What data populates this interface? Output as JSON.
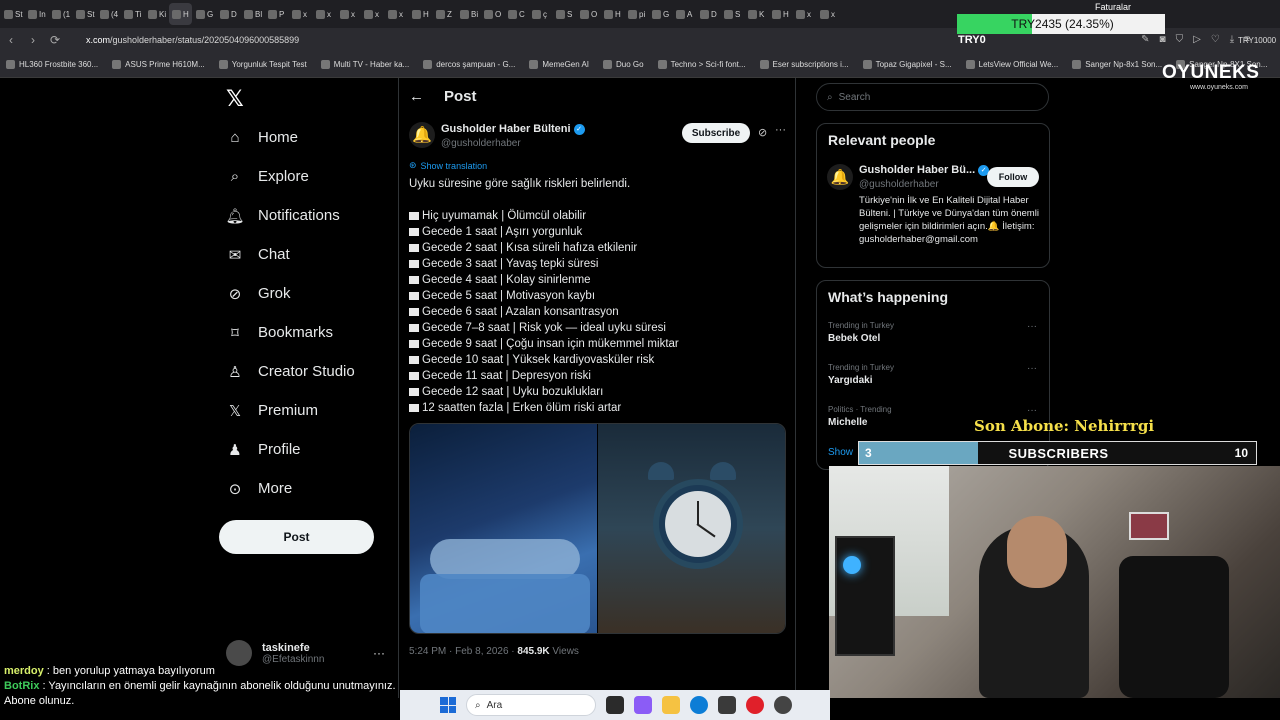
{
  "browser": {
    "tabs": [
      {
        "label": "St",
        "active": false
      },
      {
        "label": "In",
        "active": false
      },
      {
        "label": "(1",
        "active": false
      },
      {
        "label": "St",
        "active": false
      },
      {
        "label": "(4",
        "active": false
      },
      {
        "label": "Ti",
        "active": false
      },
      {
        "label": "Ki",
        "active": false
      },
      {
        "label": "H",
        "active": true
      },
      {
        "label": "G",
        "active": false
      },
      {
        "label": "D",
        "active": false
      },
      {
        "label": "Bl",
        "active": false
      },
      {
        "label": "P",
        "active": false
      },
      {
        "label": "x",
        "active": false
      },
      {
        "label": "x",
        "active": false
      },
      {
        "label": "x",
        "active": false
      },
      {
        "label": "x",
        "active": false
      },
      {
        "label": "x",
        "active": false
      },
      {
        "label": "H",
        "active": false
      },
      {
        "label": "Z",
        "active": false
      },
      {
        "label": "Bi",
        "active": false
      },
      {
        "label": "O",
        "active": false
      },
      {
        "label": "C",
        "active": false
      },
      {
        "label": "ç",
        "active": false
      },
      {
        "label": "S",
        "active": false
      },
      {
        "label": "O",
        "active": false
      },
      {
        "label": "H",
        "active": false
      },
      {
        "label": "pi",
        "active": false
      },
      {
        "label": "G",
        "active": false
      },
      {
        "label": "A",
        "active": false
      },
      {
        "label": "D",
        "active": false
      },
      {
        "label": "S",
        "active": false
      },
      {
        "label": "K",
        "active": false
      },
      {
        "label": "H",
        "active": false
      },
      {
        "label": "x",
        "active": false
      },
      {
        "label": "x",
        "active": false
      }
    ],
    "url_host": "x.com",
    "url_path": "/gusholderhaber/status/2020504096000585899",
    "bookmarks": [
      "HL360 Frostbite 360...",
      "ASUS Prime H610M...",
      "Yorgunluk Tespit Test",
      "Multi TV - Haber ka...",
      "dercos şampuan - G...",
      "MemeGen AI",
      "Duo Go",
      "Techno > Sci-fi font...",
      "Eser subscriptions i...",
      "Topaz Gigapixel - S...",
      "LetsView Official We...",
      "Sanger Np-8x1 Son...",
      "Sanger Np-8X1 Son..."
    ]
  },
  "overlay": {
    "fx_title": "Faturalar",
    "fx_value": "TRY2435 (24.35%)",
    "fx_fill_percent": 0.3629,
    "try_left": "TRY0",
    "try_right": "TRY10000",
    "brand": "OYUNEKS",
    "brand_url": "www.oyuneks.com",
    "last_sub": "Son Abone: Nehirrrgi",
    "sub_current": "3",
    "sub_label": "SUBSCRIBERS",
    "sub_goal": "10",
    "sub_fill_fraction": 0.3
  },
  "nav": {
    "items": [
      {
        "label": "Home",
        "icon": "home-icon"
      },
      {
        "label": "Explore",
        "icon": "search-icon"
      },
      {
        "label": "Notifications",
        "icon": "bell-icon"
      },
      {
        "label": "Chat",
        "icon": "mail-icon"
      },
      {
        "label": "Grok",
        "icon": "grok-icon"
      },
      {
        "label": "Bookmarks",
        "icon": "bookmark-icon"
      },
      {
        "label": "Creator Studio",
        "icon": "creator-icon"
      },
      {
        "label": "Premium",
        "icon": "x-icon"
      },
      {
        "label": "Profile",
        "icon": "person-icon"
      },
      {
        "label": "More",
        "icon": "more-icon"
      }
    ],
    "post_button": "Post"
  },
  "account": {
    "name": "taskinefe",
    "handle": "@Efetaskinnn"
  },
  "post": {
    "header": "Post",
    "author_name": "Gusholder Haber Bülteni",
    "author_handle": "@gusholderhaber",
    "subscribe_label": "Subscribe",
    "show_translation": "Show translation",
    "intro": "Uyku süresine göre sağlık riskleri belirlendi.",
    "lines": [
      "Hiç uyumamak | Ölümcül olabilir",
      "Gecede 1 saat | Aşırı yorgunluk",
      "Gecede 2 saat | Kısa süreli hafıza etkilenir",
      "Gecede 3 saat | Yavaş tepki süresi",
      "Gecede 4 saat | Kolay sinirlenme",
      "Gecede 5 saat | Motivasyon kaybı",
      "Gecede 6 saat | Azalan konsantrasyon",
      "Gecede 7–8 saat | Risk yok — ideal uyku süresi",
      "Gecede 9 saat | Çoğu insan için mükemmel miktar",
      "Gecede 10 saat | Yüksek kardiyovasküler risk",
      "Gecede 11 saat | Depresyon riski",
      "Gecede 12 saat | Uyku bozuklukları",
      "12 saatten fazla | Erken ölüm riski artar"
    ],
    "timestamp": "5:24 PM · Feb 8, 2026 · ",
    "views_count": "845.9K",
    "views_label": " Views"
  },
  "sidebar": {
    "search_placeholder": "Search",
    "relevant_title": "Relevant people",
    "person_name": "Gusholder Haber Bü...",
    "person_handle": "@gusholderhaber",
    "follow_label": "Follow",
    "person_bio": "Türkiye'nin İlk ve En Kaliteli Dijital Haber Bülteni. | Türkiye ve Dünya'dan tüm önemli gelişmeler için bildirimleri açın.🔔 İletişim: gusholderhaber@gmail.com",
    "happening_title": "What’s happening",
    "trends": [
      {
        "meta": "Trending in Turkey",
        "name": "Bebek Otel"
      },
      {
        "meta": "Trending in Turkey",
        "name": "Yargıdaki"
      },
      {
        "meta": "Politics · Trending",
        "name": "Michelle"
      }
    ],
    "show_more": "Show"
  },
  "chat": [
    {
      "user": "merdoy",
      "text": " : ben yorulup yatmaya bayılıyorum",
      "bot": false
    },
    {
      "user": "BotRix",
      "text": " : Yayıncıların en önemli gelir kaynağının abonelik olduğunu unutmayınız. Abone olunuz.",
      "bot": true
    }
  ],
  "taskbar": {
    "search_label": "Ara"
  }
}
